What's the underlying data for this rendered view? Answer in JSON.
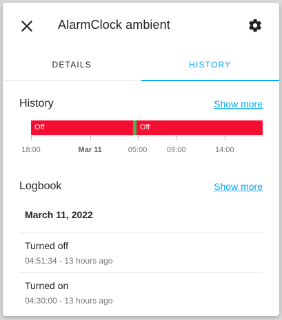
{
  "dialog": {
    "title": "AlarmClock ambient",
    "close_icon": "close-icon",
    "settings_icon": "gear-icon"
  },
  "tabs": [
    {
      "label": "DETAILS",
      "active": false
    },
    {
      "label": "HISTORY",
      "active": true
    }
  ],
  "history": {
    "title": "History",
    "show_more": "Show more",
    "segments": [
      {
        "state": "Off",
        "color": "#f50e31",
        "share": 0.44
      },
      {
        "state": "",
        "color": "#4caf50",
        "share": 0.015
      },
      {
        "state": "Off",
        "color": "#f50e31",
        "share": 0.545
      }
    ],
    "ticks": [
      {
        "label": "18:00",
        "bold": false,
        "pos": 0.0
      },
      {
        "label": "Mar 11",
        "bold": true,
        "pos": 0.255
      },
      {
        "label": "05:00",
        "bold": false,
        "pos": 0.46
      },
      {
        "label": "09:00",
        "bold": false,
        "pos": 0.627
      },
      {
        "label": "14:00",
        "bold": false,
        "pos": 0.836
      }
    ]
  },
  "logbook": {
    "title": "Logbook",
    "show_more": "Show more",
    "date": "March 11, 2022",
    "entries": [
      {
        "message": "Turned off",
        "time": "04:51:34 - 13 hours ago"
      },
      {
        "message": "Turned on",
        "time": "04:30:00 - 13 hours ago"
      }
    ]
  },
  "colors": {
    "accent": "#03a9f4",
    "off": "#f50e31",
    "on": "#4caf50"
  }
}
